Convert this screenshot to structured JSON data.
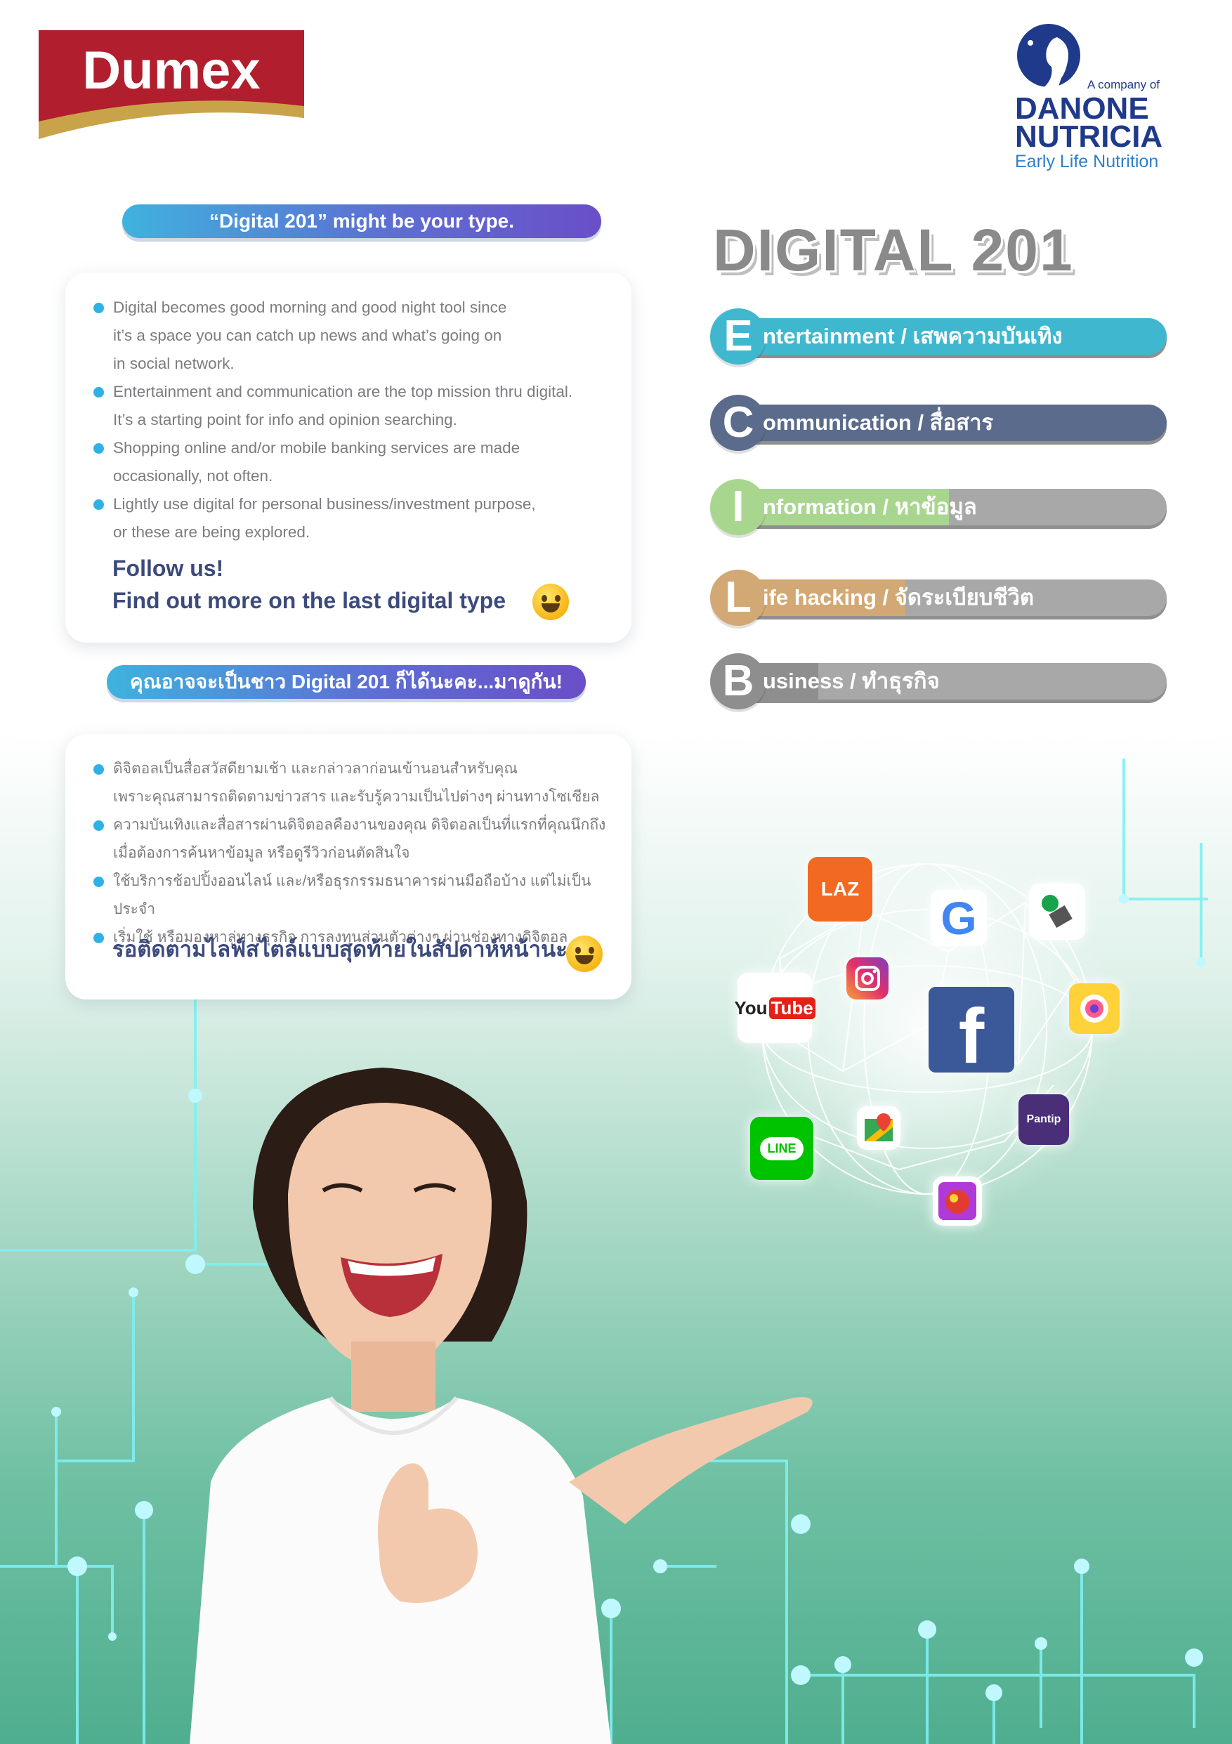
{
  "logos": {
    "dumex": "Dumex",
    "danone_company_of": "A company of",
    "danone_line1": "DANONE",
    "danone_line2": "NUTRICIA",
    "danone_sub": "Early Life Nutrition"
  },
  "english_section": {
    "header": "“Digital 201” might be your type.",
    "bullets": [
      "Digital becomes good morning and good night tool since\nit’s a space you can catch up news and what’s going on\nin social network.",
      "Entertainment and communication are the top mission thru digital.\nIt’s a starting point for info and opinion searching.",
      "Shopping online and/or mobile banking services are made\noccasionally, not often.",
      "Lightly use digital for personal business/investment purpose,\nor these are being explored."
    ],
    "follow_line1": "Follow us!",
    "follow_line2": "Find out more on the last digital type"
  },
  "thai_section": {
    "header": "คุณอาจจะเป็นชาว Digital 201 ก็ได้นะคะ...มาดูกัน!",
    "bullets": [
      "ดิจิตอลเป็นสื่อสวัสดียามเช้า และกล่าวลาก่อนเข้านอนสำหรับคุณ\nเพราะคุณสามารถติดตามข่าวสาร และรับรู้ความเป็นไปต่างๆ ผ่านทางโซเชียล",
      "ความบันเทิงและสื่อสารผ่านดิจิตอลคืองานของคุณ ดิจิตอลเป็นที่แรกที่คุณนึกถึง\nเมื่อต้องการค้นหาข้อมูล หรือดูรีวิวก่อนตัดสินใจ",
      "ใช้บริการช้อปปิ้งออนไลน์ และ/หรือธุรกรรมธนาคารผ่านมือถือบ้าง แต่ไม่เป็นประจำ",
      "เริ่มใช้ หรือมองหาลู่ทางธุรกิจ การลงทุนส่วนตัวต่างๆ ผ่านช่องทางดิจิตอล"
    ],
    "follow": "รอติดตามไลฟ์สไตล์แบบสุดท้ายในสัปดาห์หน้านะคะ"
  },
  "title": "DIGITAL 201",
  "categories": [
    {
      "letter": "E",
      "label": "ntertainment / เสพความบันเทิง",
      "level": 1.0,
      "color": "#3fb8cf"
    },
    {
      "letter": "C",
      "label": "ommunication / สื่อสาร",
      "level": 1.0,
      "color": "#5a6b8c"
    },
    {
      "letter": "I",
      "label": "nformation / หาข้อมูล",
      "level": 0.5,
      "color": "#a9d68f"
    },
    {
      "letter": "L",
      "label": "ife hacking / จัดระเบียบชีวิต",
      "level": 0.4,
      "color": "#d2a874"
    },
    {
      "letter": "B",
      "label": "usiness / ทำธุรกิจ",
      "level": 0.2,
      "color": "#8e8e8e"
    }
  ],
  "apps": {
    "lazada": "LAZ",
    "youtube_1": "You",
    "youtube_2": "Tube",
    "line": "LINE",
    "pantip": "Pantip",
    "google": "G",
    "facebook": "f"
  }
}
